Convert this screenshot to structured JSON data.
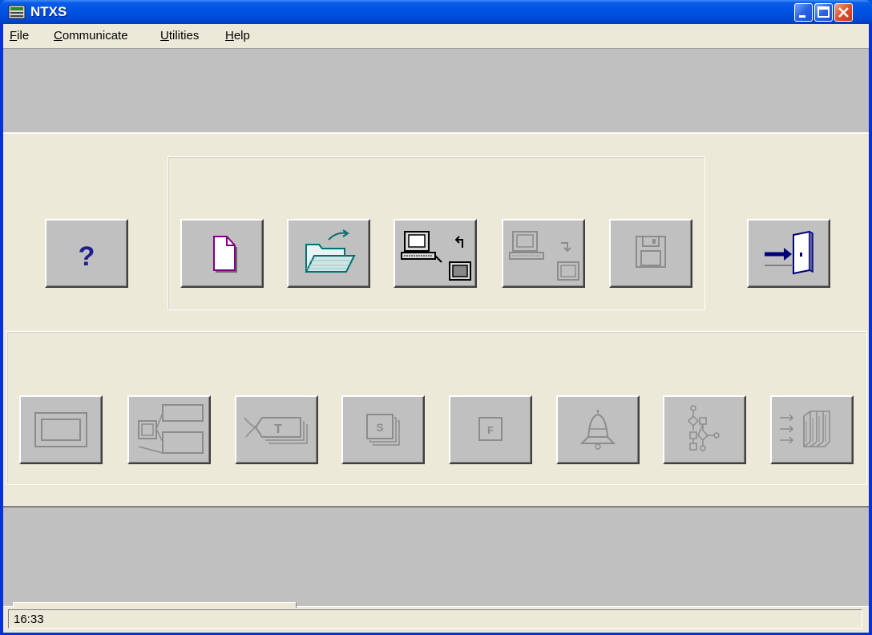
{
  "window": {
    "title": "NTXS",
    "icon_name": "ntxs-app-icon",
    "controls": [
      "minimize-icon",
      "maximize-icon",
      "close-icon"
    ]
  },
  "menu": {
    "items": [
      {
        "label": "File",
        "mnemonic": "F"
      },
      {
        "label": "Communicate",
        "mnemonic": "C"
      },
      {
        "label": "Utilities",
        "mnemonic": "U"
      },
      {
        "label": "Help",
        "mnemonic": "H"
      }
    ]
  },
  "top_buttons": [
    {
      "name": "help-button",
      "icon": "question-mark-icon",
      "enabled": true
    },
    {
      "name": "new-file-button",
      "icon": "new-document-icon",
      "enabled": true
    },
    {
      "name": "open-file-button",
      "icon": "open-folder-icon",
      "enabled": true
    },
    {
      "name": "upload-from-pt-button",
      "icon": "computer-download-icon",
      "enabled": true
    },
    {
      "name": "download-to-pt-button",
      "icon": "computer-upload-icon",
      "enabled": false
    },
    {
      "name": "save-button",
      "icon": "floppy-disk-icon",
      "enabled": false
    },
    {
      "name": "exit-button",
      "icon": "exit-door-icon",
      "enabled": true
    }
  ],
  "bottom_buttons": [
    {
      "name": "screen-button",
      "icon": "screen-frame-icon",
      "enabled": false
    },
    {
      "name": "screen-list-button",
      "icon": "screen-tree-icon",
      "enabled": false
    },
    {
      "name": "tag-button",
      "icon": "tag-T-icon",
      "enabled": false,
      "glyph": "T"
    },
    {
      "name": "string-button",
      "icon": "stack-S-icon",
      "enabled": false,
      "glyph": "S"
    },
    {
      "name": "function-button",
      "icon": "box-F-icon",
      "enabled": false,
      "glyph": "F"
    },
    {
      "name": "alarm-button",
      "icon": "bell-icon",
      "enabled": false
    },
    {
      "name": "flow-button",
      "icon": "flowchart-icon",
      "enabled": false
    },
    {
      "name": "transfer-button",
      "icon": "arrows-files-icon",
      "enabled": false
    }
  ],
  "status": {
    "time": "16:33"
  },
  "colors": {
    "titlebar": "#0054e3",
    "panel": "#ece9d8",
    "button_face": "#c0c0c0",
    "disabled_icon": "#8c8c8c",
    "help_icon": "#1e1e8c"
  }
}
